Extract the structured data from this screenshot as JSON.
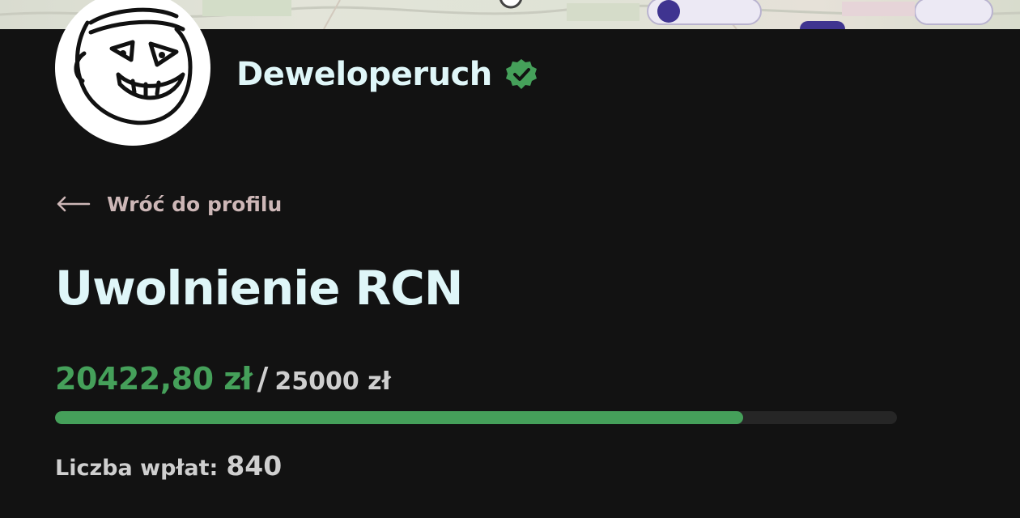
{
  "profile": {
    "username": "Deweloperuch",
    "verified": true,
    "avatar_icon": "trollface-avatar-icon",
    "verified_icon": "verified-badge-icon",
    "verified_color": "#45a05a"
  },
  "back_link": {
    "icon": "arrow-left-icon",
    "label": "Wróć do profilu"
  },
  "campaign": {
    "title": "Uwolnienie RCN",
    "raised": "20422,80 zł",
    "separator": "/",
    "goal": "25000 zł",
    "progress_fraction": 0.8169,
    "donations_label": "Liczba wpłat:",
    "donations_count": "840"
  },
  "colors": {
    "background": "#121212",
    "accent": "#45a05a",
    "title_text": "#dff6f8",
    "link_text": "#cdb7b7",
    "track": "#262626"
  }
}
